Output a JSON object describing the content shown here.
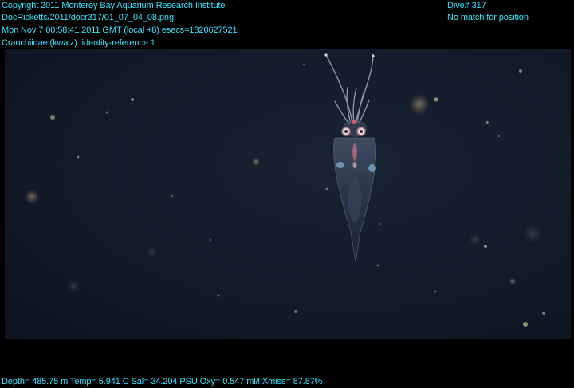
{
  "overlay": {
    "copyright": "Copyright 2011 Monterey Bay Aquarium Research Institute",
    "file_path": "DocRicketts/2011/docr317/01_07_04_08.png",
    "timestamp": "Mon Nov  7 00:58:41 2011 GMT (local +8)  esecs=1320627521",
    "annotation": "Cranchiidae (kwalz): identity-reference 1",
    "dive": "Dive# 317",
    "position_status": "No match for position",
    "sensor_readout": "Depth= 485.75 m  Temp= 5.941 C  Sal= 34.204 PSU  Oxy= 0.547 ml/l  Xmiss= 87.87%"
  },
  "colors": {
    "overlay_text": "#2ee6ff",
    "background": "#000000",
    "water": "#141c2b"
  }
}
